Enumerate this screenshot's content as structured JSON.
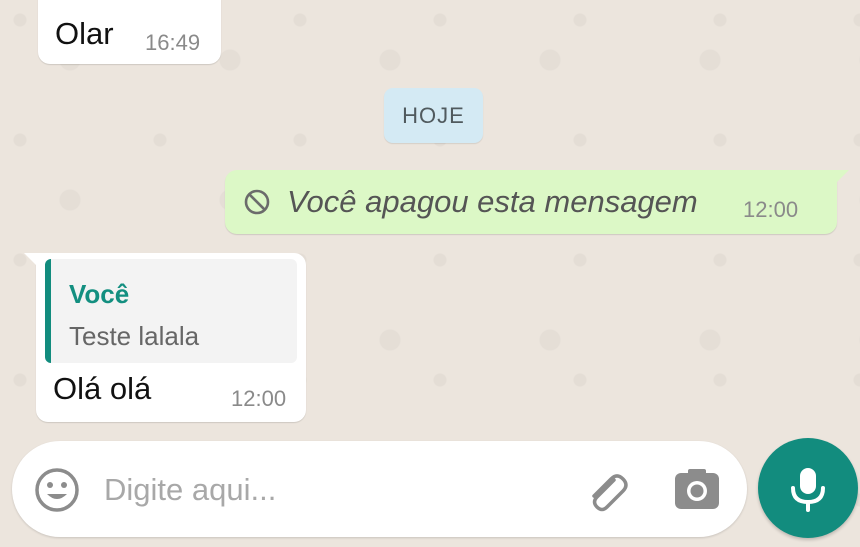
{
  "chat": {
    "messages": [
      {
        "direction": "incoming",
        "text": "Olar",
        "time": "16:49"
      },
      {
        "direction": "outgoing",
        "deleted": true,
        "icon": "ban-icon",
        "text": "Você apagou esta mensagem",
        "time": "12:00"
      },
      {
        "direction": "incoming",
        "quote": {
          "author": "Você",
          "text": "Teste lalala"
        },
        "text": "Olá olá",
        "time": "12:00"
      }
    ],
    "day_separator": "HOJE"
  },
  "composer": {
    "placeholder": "Digite aqui...",
    "value": "",
    "emoji_icon": "emoji-icon",
    "attach_icon": "paperclip-icon",
    "camera_icon": "camera-icon",
    "mic_icon": "microphone-icon"
  },
  "colors": {
    "background": "#ece5dd",
    "outgoing_bubble": "#dcf8c6",
    "incoming_bubble": "#ffffff",
    "day_pill": "#d4eaf4",
    "accent": "#128c7e"
  }
}
